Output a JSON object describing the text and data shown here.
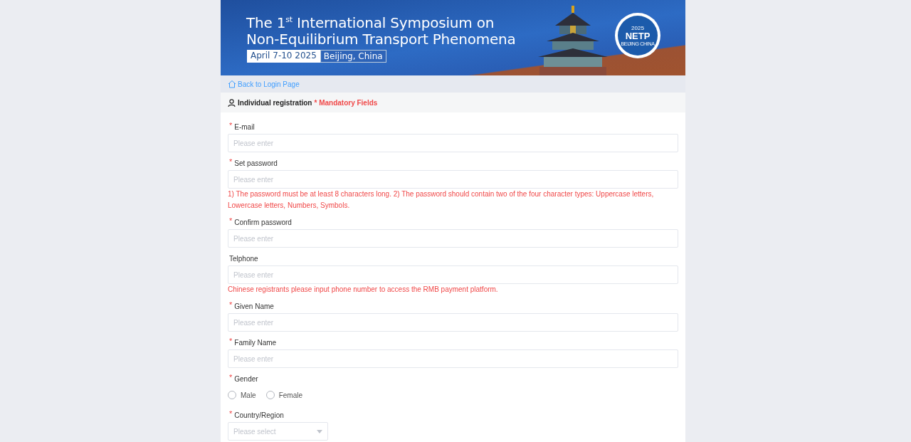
{
  "banner": {
    "title_lines": [
      "The 1$^{st}$ International Symposium on",
      "Non-Equilibrium Transport Phenomena"
    ],
    "dates": "April 7-10 2025",
    "location": "Beijing, China",
    "logo": {
      "year": "2025",
      "name": "NETP",
      "place": "BEIJING CHINA"
    }
  },
  "back_link": "Back to Login Page",
  "section": {
    "title": "Individual registration",
    "mandatory_note": "* Mandatory Fields"
  },
  "fields": [
    {
      "kind": "text",
      "label": "E-mail",
      "required_mark": "*",
      "placeholder": "Please enter"
    },
    {
      "kind": "text",
      "label": "Set password",
      "required_mark": "*",
      "placeholder": "Please enter",
      "hint": "1) The password must be at least 8 characters long. 2) The password should contain two of the four character types: Uppercase letters, Lowercase letters, Numbers, Symbols."
    },
    {
      "kind": "text",
      "label": "Confirm password",
      "required_mark": "*",
      "placeholder": "Please enter"
    },
    {
      "kind": "text",
      "label": "Telphone",
      "placeholder": "Please enter",
      "hint": "Chinese registrants please input phone number to access the RMB payment platform."
    },
    {
      "kind": "text",
      "label": "Given Name",
      "required_mark": "*",
      "placeholder": "Please enter"
    },
    {
      "kind": "text",
      "label": "Family Name",
      "required_mark": "*",
      "placeholder": "Please enter"
    },
    {
      "kind": "radio",
      "label": "Gender",
      "required_mark": "*",
      "options": [
        {
          "label": "Male",
          "selected": false
        },
        {
          "label": "Female",
          "selected": false
        }
      ]
    },
    {
      "kind": "select",
      "label": "Country/Region",
      "required_mark": "*",
      "placeholder": "Please select"
    }
  ]
}
